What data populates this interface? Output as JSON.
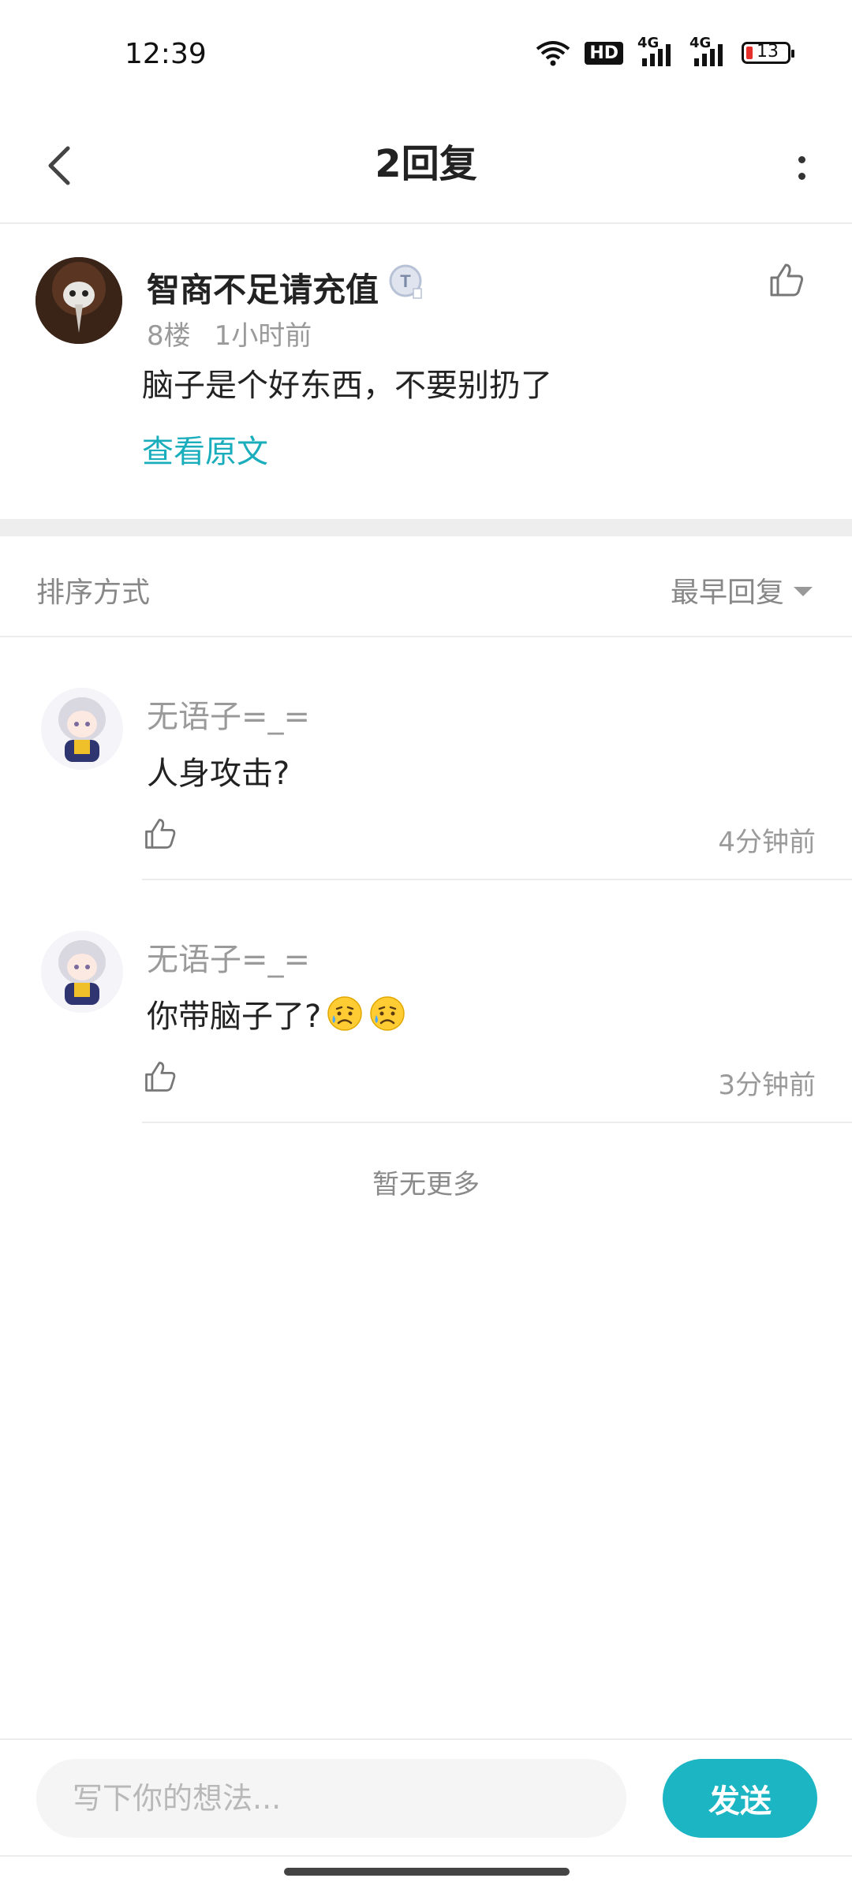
{
  "status_bar": {
    "time": "12:39",
    "hd_label": "HD",
    "network_1": "4G",
    "network_2": "4G",
    "battery_level": "13",
    "battery_color": "#e6302b"
  },
  "header": {
    "title": "2回复"
  },
  "original_comment": {
    "username": "智商不足请充值",
    "floor": "8楼",
    "time": "1小时前",
    "content": "脑子是个好东西，不要别扔了",
    "view_original_label": "查看原文"
  },
  "sort": {
    "label": "排序方式",
    "selected": "最早回复"
  },
  "replies": [
    {
      "username": "无语子=_=",
      "content": "人身攻击?",
      "emojis": [],
      "time": "4分钟前"
    },
    {
      "username": "无语子=_=",
      "content": "你带脑子了?",
      "emojis": [
        "sad-sweat-emoji",
        "sad-sweat-emoji"
      ],
      "time": "3分钟前"
    }
  ],
  "no_more_label": "暂无更多",
  "input": {
    "placeholder": "写下你的想法...",
    "send_label": "发送"
  },
  "colors": {
    "accent": "#1bb5c3",
    "link": "#1aaebd",
    "muted_text": "#9a9a9a"
  }
}
